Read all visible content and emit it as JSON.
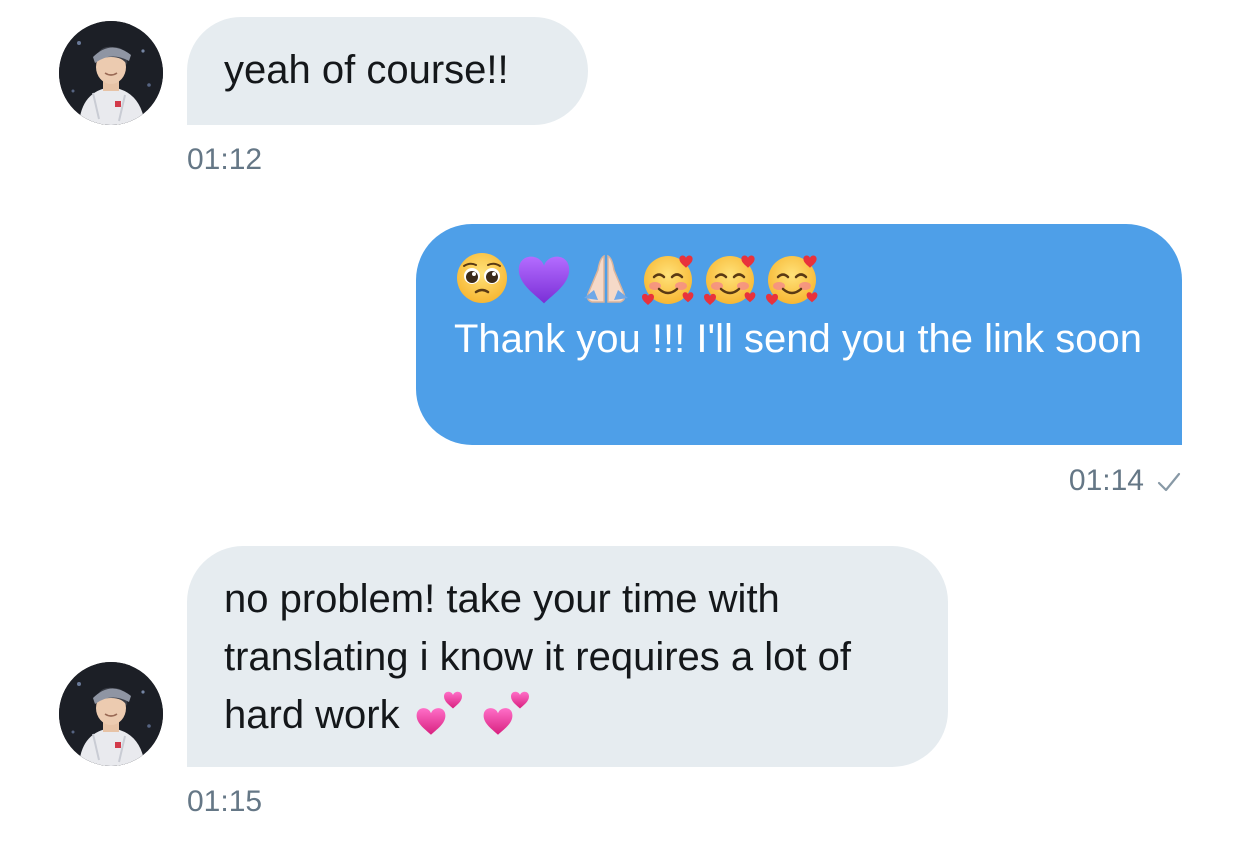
{
  "conversation": {
    "messages": [
      {
        "direction": "incoming",
        "text": "yeah of course!!",
        "time": "01:12"
      },
      {
        "direction": "outgoing",
        "emojis": [
          "pleading-face",
          "purple-heart",
          "folded-hands",
          "smiling-face-with-hearts",
          "smiling-face-with-hearts",
          "smiling-face-with-hearts"
        ],
        "text": "Thank you !!! I'll send you the link soon",
        "time": "01:14",
        "status_icon": "sent-check-icon"
      },
      {
        "direction": "incoming",
        "text": "no problem! take your time with translating i know it requires a lot of hard work",
        "trailing_emojis": [
          "two-hearts",
          "two-hearts"
        ],
        "time": "01:15"
      }
    ]
  },
  "colors": {
    "incoming_bubble": "#e6ecf0",
    "outgoing_bubble": "#4e9fe8",
    "timestamp": "#657786",
    "text_dark": "#14171a"
  }
}
